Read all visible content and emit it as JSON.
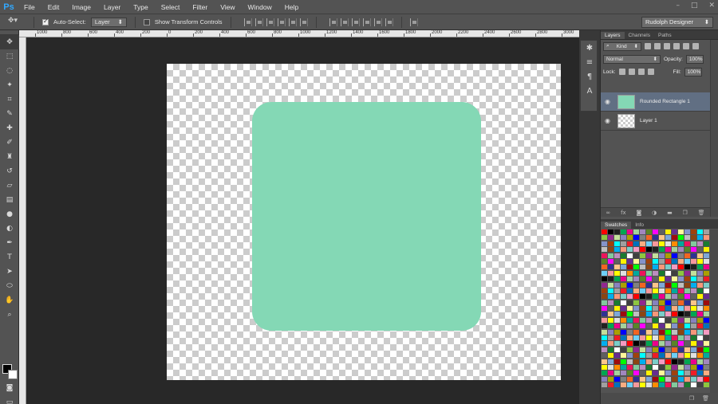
{
  "app": {
    "logo": "Ps"
  },
  "menu": [
    "File",
    "Edit",
    "Image",
    "Layer",
    "Type",
    "Select",
    "Filter",
    "View",
    "Window",
    "Help"
  ],
  "options_bar": {
    "auto_select_label": "Auto-Select:",
    "auto_select_value": "Layer",
    "show_transform_label": "Show Transform Controls",
    "workspace": "Rudolph Designer"
  },
  "ruler_labels": [
    "1000",
    "800",
    "600",
    "400",
    "200",
    "0",
    "200",
    "400",
    "600",
    "800",
    "1000",
    "1200",
    "1400",
    "1600",
    "1800",
    "2000",
    "2200",
    "2400",
    "2600",
    "2800",
    "3000"
  ],
  "layers_panel": {
    "tabs": [
      "Layers",
      "Channels",
      "Paths"
    ],
    "kind_filter": "Kind",
    "blend_mode": "Normal",
    "opacity_label": "Opacity:",
    "opacity_value": "100%",
    "lock_label": "Lock:",
    "fill_label": "Fill:",
    "fill_value": "100%",
    "layers": [
      {
        "name": "Rounded Rectangle 1",
        "selected": true
      },
      {
        "name": "Layer 1",
        "selected": false
      }
    ]
  },
  "swatches_panel": {
    "tabs": [
      "Swatches",
      "Info"
    ]
  },
  "colors": {
    "shape_fill": "#84d8b5",
    "selection": "#616f83"
  }
}
